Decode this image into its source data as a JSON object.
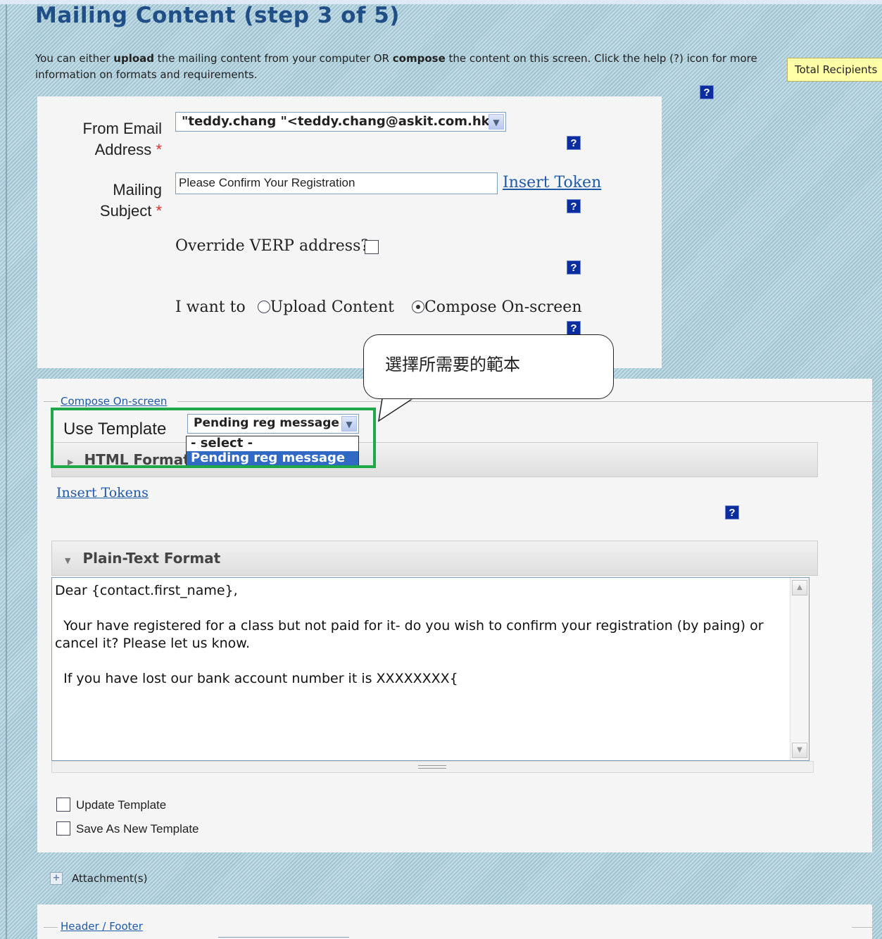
{
  "page": {
    "title": "Mailing Content (step 3 of 5)",
    "intro_part1": "You can either ",
    "intro_upload": "upload",
    "intro_part2": " the mailing content from your computer OR ",
    "intro_compose": "compose",
    "intro_part3": " the content on this screen. Click the help (?) icon for more information on formats and requirements.",
    "total_recipients": "Total Recipients"
  },
  "help_icon": "?",
  "form": {
    "from_label_line1": "From Email",
    "from_label_line2": "Address",
    "required_mark": "*",
    "from_value": "\"teddy.chang \"<teddy.chang@askit.com.hk>",
    "subject_label_line1": "Mailing",
    "subject_label_line2": "Subject",
    "subject_value": "Please Confirm Your Registration",
    "insert_token": "Insert Token",
    "override_verp": "Override VERP address?",
    "i_want_to": "I want to",
    "radio_upload": "Upload Content",
    "radio_compose": "Compose On-screen",
    "selected_mode": "compose"
  },
  "callout": {
    "text": "選擇所需要的範本"
  },
  "compose": {
    "legend": "Compose On-screen",
    "use_template_label": "Use Template",
    "template_selected": "Pending reg message",
    "template_options": [
      "- select -",
      "Pending reg message"
    ],
    "html_format_label": "HTML Format",
    "insert_tokens": "Insert Tokens",
    "plain_text_label": "Plain-Text Format",
    "plain_text_body": "Dear {contact.first_name},\n\n  Your have registered for a class but not paid for it- do you wish to confirm your registration (by paing) or cancel it? Please let us know.\n\n  If you have lost our bank account number it is XXXXXXXX{",
    "update_template": "Update Template",
    "save_as_new_template": "Save As New Template"
  },
  "attachments": {
    "label": "Attachment(s)"
  },
  "header_footer": {
    "legend": "Header / Footer"
  }
}
